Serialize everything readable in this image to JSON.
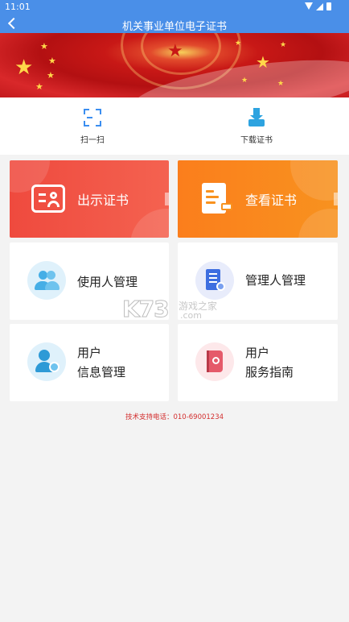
{
  "status_bar": {
    "time": "11:01"
  },
  "nav": {
    "title": "机关事业单位电子证书"
  },
  "tools": [
    {
      "label": "扫一扫",
      "icon": "scan-icon"
    },
    {
      "label": "下载证书",
      "icon": "download-icon"
    }
  ],
  "main_cards": [
    {
      "label": "出示证书",
      "icon": "id-card-icon",
      "color": "#f0503f"
    },
    {
      "label": "查看证书",
      "icon": "document-icon",
      "color": "#fa861d"
    }
  ],
  "menu_cards": [
    {
      "label_lines": [
        "使用人管理"
      ],
      "icon": "users-icon"
    },
    {
      "label_lines": [
        "管理人管理"
      ],
      "icon": "manager-icon"
    },
    {
      "label_lines": [
        "用户",
        "信息管理"
      ],
      "icon": "user-info-icon"
    },
    {
      "label_lines": [
        "用户",
        "服务指南"
      ],
      "icon": "guide-book-icon"
    }
  ],
  "watermark": {
    "big": "K73",
    "line1": "游戏之家",
    "line2": ".com"
  },
  "footer": {
    "tel": "技术支持电话：010-69001234"
  },
  "colors": {
    "primary": "#4a8fe8",
    "red_card": "#f0503f",
    "orange_card": "#fa861d",
    "footer_text": "#d32f2f"
  }
}
